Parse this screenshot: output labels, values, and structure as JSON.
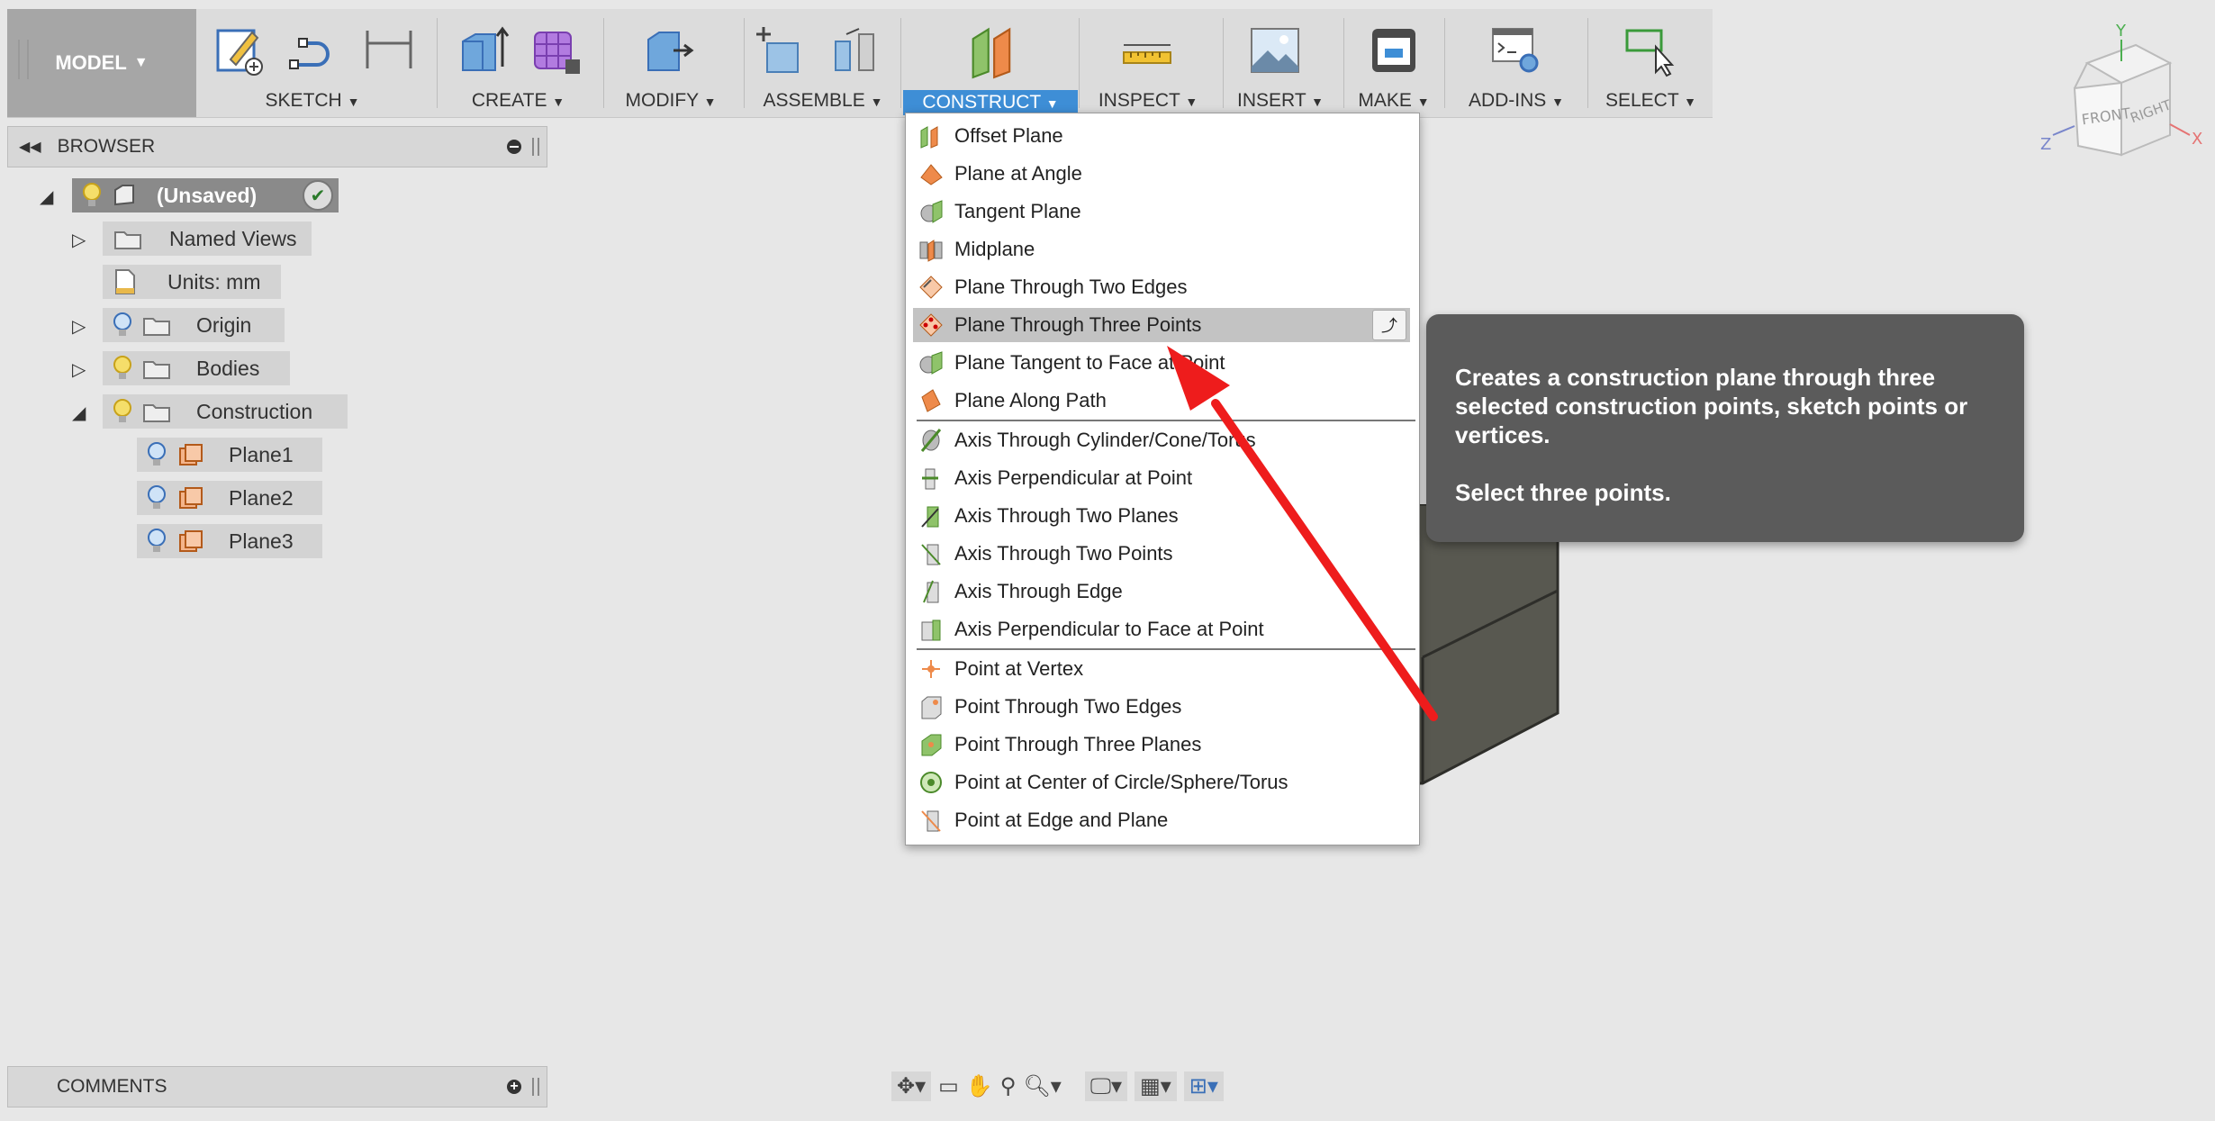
{
  "toolbar": {
    "mode_label": "MODEL",
    "groups": [
      {
        "label": "SKETCH"
      },
      {
        "label": "CREATE"
      },
      {
        "label": "MODIFY"
      },
      {
        "label": "ASSEMBLE"
      },
      {
        "label": "CONSTRUCT"
      },
      {
        "label": "INSPECT"
      },
      {
        "label": "INSERT"
      },
      {
        "label": "MAKE"
      },
      {
        "label": "ADD-INS"
      },
      {
        "label": "SELECT"
      }
    ],
    "active_group": "CONSTRUCT",
    "accent_color": "#3e8ed6"
  },
  "browser": {
    "title": "BROWSER",
    "root": "(Unsaved)",
    "items": [
      {
        "label": "Named Views"
      },
      {
        "label": "Units: mm"
      },
      {
        "label": "Origin"
      },
      {
        "label": "Bodies"
      },
      {
        "label": "Construction"
      },
      {
        "label": "Plane1"
      },
      {
        "label": "Plane2"
      },
      {
        "label": "Plane3"
      }
    ]
  },
  "construct_menu": {
    "items": [
      {
        "label": "Offset Plane"
      },
      {
        "label": "Plane at Angle"
      },
      {
        "label": "Tangent Plane"
      },
      {
        "label": "Midplane"
      },
      {
        "label": "Plane Through Two Edges"
      },
      {
        "label": "Plane Through Three Points"
      },
      {
        "label": "Plane Tangent to Face at Point"
      },
      {
        "label": "Plane Along Path"
      },
      {
        "label": "Axis Through Cylinder/Cone/Torus"
      },
      {
        "label": "Axis Perpendicular at Point"
      },
      {
        "label": "Axis Through Two Planes"
      },
      {
        "label": "Axis Through Two Points"
      },
      {
        "label": "Axis Through Edge"
      },
      {
        "label": "Axis Perpendicular to Face at Point"
      },
      {
        "label": "Point at Vertex"
      },
      {
        "label": "Point Through Two Edges"
      },
      {
        "label": "Point Through Three Planes"
      },
      {
        "label": "Point at Center of Circle/Sphere/Torus"
      },
      {
        "label": "Point at Edge and Plane"
      }
    ],
    "selected": "Plane Through Three Points"
  },
  "tooltip": {
    "description": "Creates a construction plane through three selected construction points, sketch points or vertices.",
    "instruction": "Select three points."
  },
  "comments": {
    "title": "COMMENTS"
  },
  "viewcube": {
    "front": "FRONT",
    "right": "RIGHT",
    "axis_x": "X",
    "axis_y": "Y",
    "axis_z": "Z"
  },
  "annotation_color": "#ee1c1c"
}
